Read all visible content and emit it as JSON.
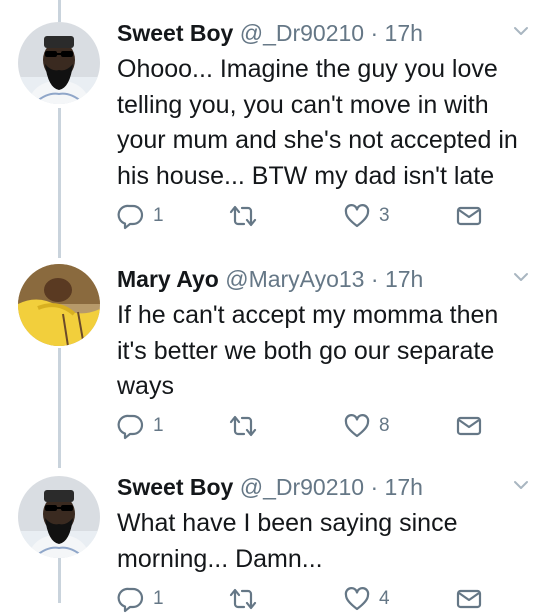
{
  "tweets": [
    {
      "name": "Sweet Boy",
      "handle": "@_Dr90210",
      "separator": "·",
      "time": "17h",
      "text": "Ohooo... Imagine the guy you love telling you,  you can't move in with your mum and she's not accepted in his house... BTW my dad isn't late",
      "reply_count": "1",
      "retweet_count": "",
      "like_count": "3",
      "avatar": "man-with-beard-and-sunglasses"
    },
    {
      "name": "Mary Ayo",
      "handle": "@MaryAyo13",
      "separator": "·",
      "time": "17h",
      "text": "If he can't accept my momma then it's better we both go our separate ways",
      "reply_count": "1",
      "retweet_count": "",
      "like_count": "8",
      "avatar": "woman-in-yellow"
    },
    {
      "name": "Sweet Boy",
      "handle": "@_Dr90210",
      "separator": "·",
      "time": "17h",
      "text": "What have I been saying since morning... Damn...",
      "reply_count": "1",
      "retweet_count": "",
      "like_count": "4",
      "avatar": "man-with-beard-and-sunglasses"
    }
  ],
  "icons": {
    "reply": "reply-icon",
    "retweet": "retweet-icon",
    "like": "heart-icon",
    "message": "envelope-icon",
    "menu": "chevron-down-icon"
  },
  "colors": {
    "text": "#14171a",
    "secondary": "#657786",
    "thread_line": "#c9d3dc"
  }
}
